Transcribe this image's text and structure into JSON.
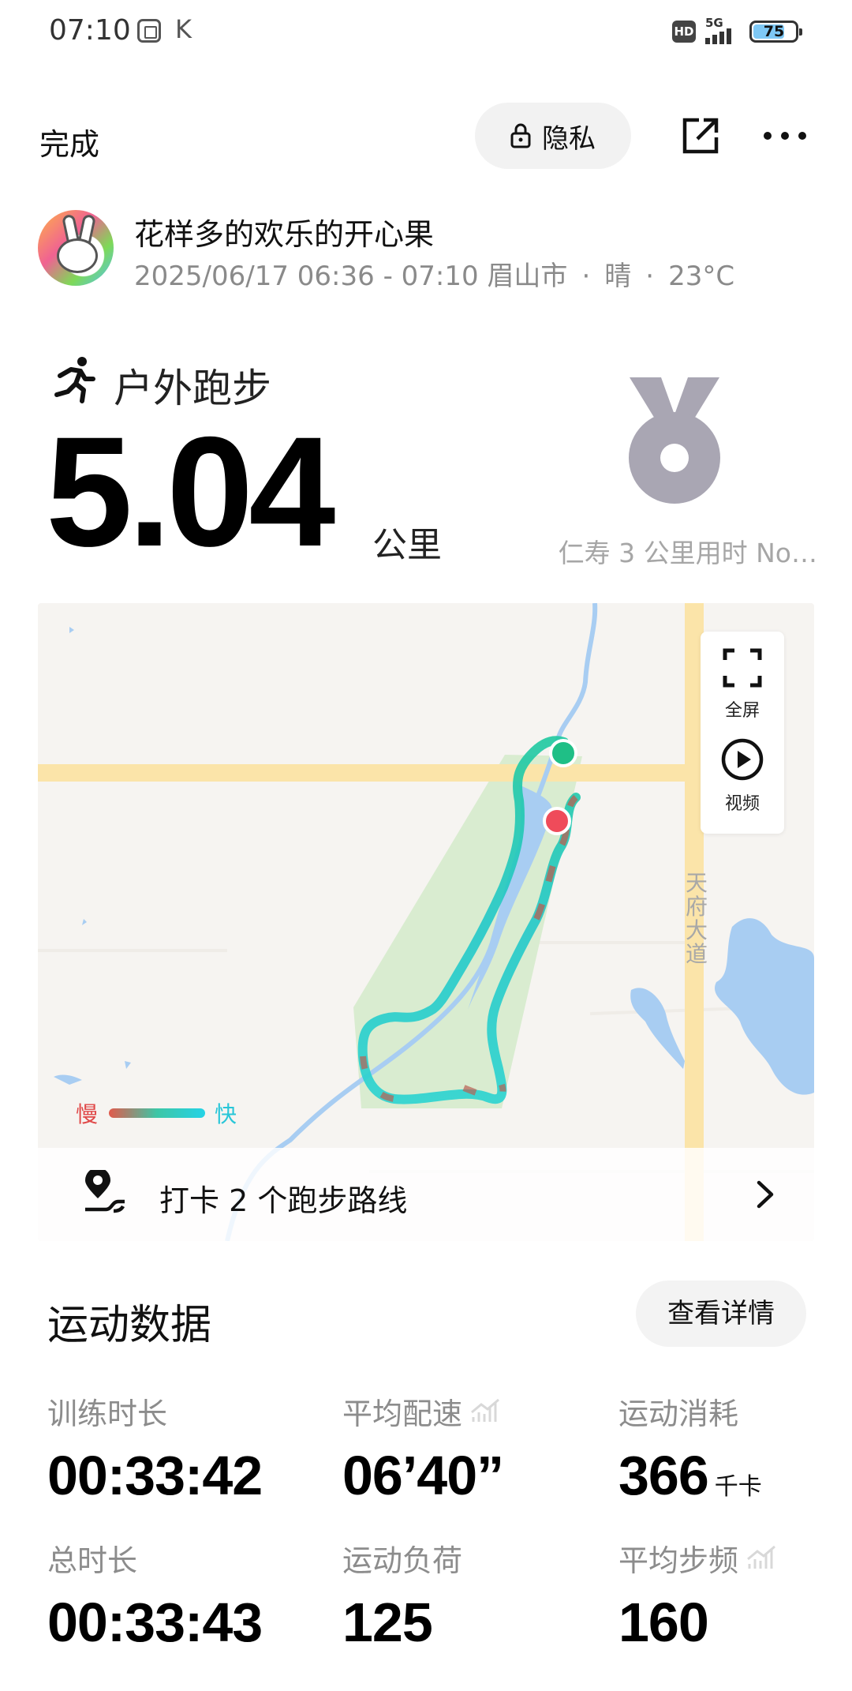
{
  "status_bar": {
    "time": "07:10",
    "k_label": "K",
    "hd": "HD",
    "network": "5G",
    "battery": "75",
    "battery_level": 0.75
  },
  "header": {
    "done_label": "完成",
    "privacy_label": "隐私"
  },
  "profile": {
    "name": "花样多的欢乐的开心果",
    "time_range": "2025/06/17 06:36 - 07:10",
    "city": "眉山市",
    "weather": "晴",
    "temperature": "23°C",
    "separator": "·"
  },
  "activity": {
    "type": "户外跑步",
    "distance": "5.04",
    "unit": "公里",
    "medal_label": "仁寿 3 公里用时 No…"
  },
  "map": {
    "tools": {
      "fullscreen": "全屏",
      "video": "视频"
    },
    "road_label": "天府大道",
    "legend": {
      "slow": "慢",
      "fast": "快"
    },
    "route_prompt": "打卡 2 个跑步路线"
  },
  "stats": {
    "section_title": "运动数据",
    "detail_button": "查看详情",
    "items": [
      {
        "label": "训练时长",
        "value": "00:33:42",
        "unit": ""
      },
      {
        "label": "平均配速",
        "value": "06’40”",
        "unit": ""
      },
      {
        "label": "运动消耗",
        "value": "366",
        "unit": "千卡"
      },
      {
        "label": "总时长",
        "value": "00:33:43",
        "unit": ""
      },
      {
        "label": "运动负荷",
        "value": "125",
        "unit": ""
      },
      {
        "label": "平均步频",
        "value": "160",
        "unit": ""
      }
    ]
  },
  "colors": {
    "route_start": "#1fbf86",
    "route_end": "#ef4b5a",
    "slow": "#e04848",
    "fast": "#28c6d8",
    "water": "#a8cdf2",
    "road": "#fbe4a9",
    "park": "#d9ecd0"
  }
}
